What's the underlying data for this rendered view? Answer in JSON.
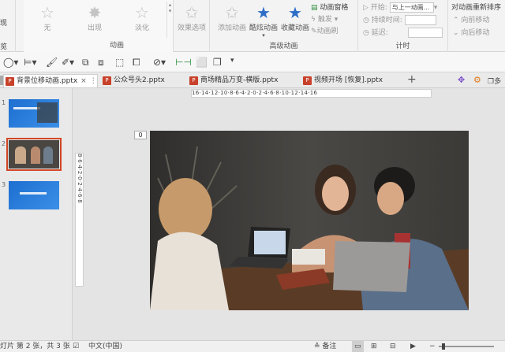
{
  "ribbon": {
    "partial_left_top": "现",
    "partial_left_bottom": "览",
    "animation_group": {
      "label": "动画",
      "buttons": [
        {
          "label": "无",
          "icon": "star-icon"
        },
        {
          "label": "出现",
          "icon": "star-burst-icon"
        },
        {
          "label": "淡化",
          "icon": "star-icon"
        }
      ]
    },
    "effect_options": "效果选项",
    "advanced_group": {
      "label": "高级动画",
      "add_animation": "添加动画",
      "cool_animation": "酷炫动画",
      "collect_animation": "收藏动画",
      "animation_pane": "动画窗格",
      "trigger": "触发",
      "animation_painter": "动画刷"
    },
    "timing_group": {
      "label": "计时",
      "start_label": "开始:",
      "start_value": "与上一动画...",
      "duration_label": "持续时间:",
      "delay_label": "延迟:",
      "reorder_title": "对动画重新排序",
      "move_earlier": "向前移动",
      "move_later": "向后移动"
    }
  },
  "tabs": [
    {
      "label": "背景位移动画.pptx",
      "active": true
    },
    {
      "label": "公众号头2.pptx",
      "active": false
    },
    {
      "label": "商场精品万变-横版.pptx",
      "active": false
    },
    {
      "label": "视频开场 [恢复].pptx",
      "active": false
    }
  ],
  "tab_add": "+",
  "tab_right_partial": "多",
  "ruler_h": "16·14·12·10·8·6·4·2·0·2·4·6·8·10·12·14·16",
  "ruler_v": "8·6·4·2·0·2·4·6·8",
  "slide_number_badge": "0",
  "thumbnails": [
    {
      "num": "1",
      "selected": false
    },
    {
      "num": "2",
      "selected": true
    },
    {
      "num": "3",
      "selected": false
    }
  ],
  "status": {
    "slide_info": "灯片 第 2 张，共 3 张",
    "language": "中文(中国)",
    "notes": "备注"
  },
  "colors": {
    "accent": "#d24726",
    "brand_blue": "#2f6ec7"
  }
}
